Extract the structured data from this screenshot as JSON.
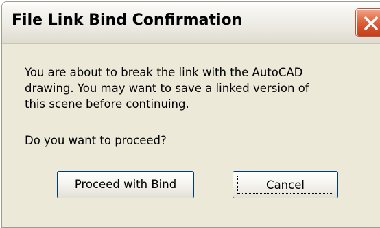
{
  "window": {
    "title": "File Link Bind Confirmation",
    "close_icon": "close-x-icon"
  },
  "dialog": {
    "message_lines": [
      "You are about to break the link with the AutoCAD",
      "drawing. You may want to save a linked version of",
      "this scene before continuing."
    ],
    "question": "Do you want to proceed?"
  },
  "buttons": {
    "proceed_label": "Proceed with Bind",
    "cancel_label": "Cancel"
  },
  "colors": {
    "dialog_bg": "#ece9d8",
    "close_button": "#d4502a",
    "button_border": "#003c74"
  }
}
